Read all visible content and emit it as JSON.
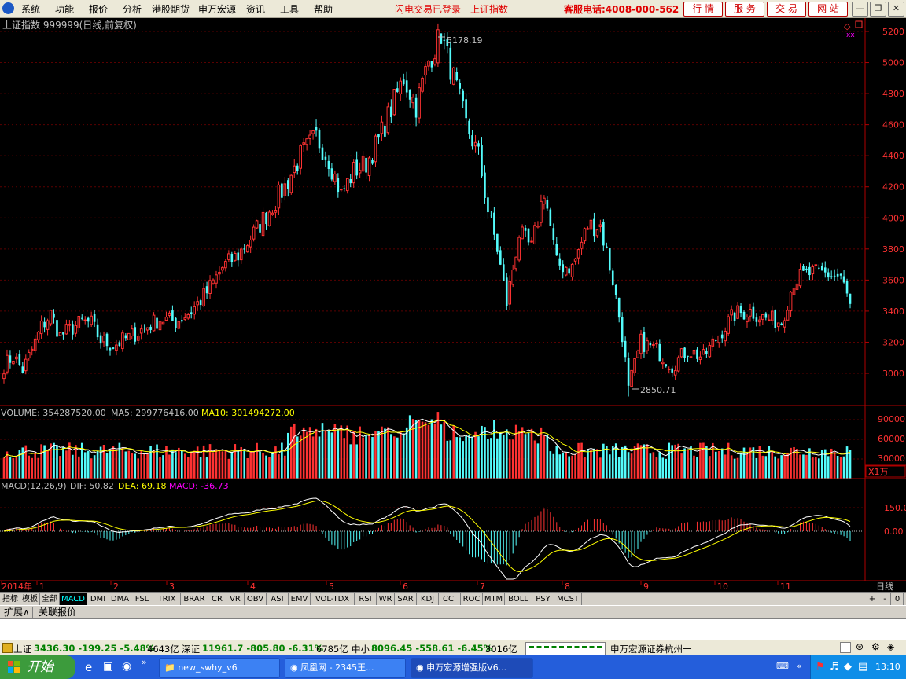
{
  "menubar": {
    "items": [
      "系统",
      "功能",
      "报价",
      "分析",
      "港股期货",
      "申万宏源",
      "资讯",
      "工具",
      "帮助"
    ],
    "notice1": "闪电交易已登录",
    "notice2": "上证指数",
    "hotline": "客服电话:4008-000-562",
    "buttons": [
      "行 情",
      "服 务",
      "交 易",
      "网 站"
    ]
  },
  "chart": {
    "title": "上证指数 999999(日线,前复权)",
    "high_label": "5178.19",
    "low_label": "2850.71",
    "price_ticks": [
      "5200",
      "5000",
      "4800",
      "4600",
      "4400",
      "4200",
      "4000",
      "3800",
      "3600",
      "3400",
      "3200",
      "3000"
    ],
    "volume_header": {
      "label": "VOLUME: 354287520.00",
      "ma5": "MA5: 299776416.00",
      "ma10": "MA10: 301494272.00"
    },
    "volume_ticks": [
      "90000",
      "60000",
      "30000"
    ],
    "volume_unit": "X1万",
    "macd_header": {
      "label": "MACD(12,26,9)",
      "dif": "DIF: 50.82",
      "dea": "DEA: 69.18",
      "macd": "MACD: -36.73"
    },
    "macd_ticks": [
      "150.0",
      "0.00"
    ],
    "x_labels": [
      "2014年",
      "1",
      "2",
      "3",
      "4",
      "5",
      "6",
      "7",
      "8",
      "9",
      "10",
      "11"
    ],
    "period": "日线",
    "colors": {
      "up": "#ff3232",
      "down": "#54fcfc",
      "dif": "#ffffff",
      "dea": "#ffff00",
      "macd": "#ff00ff",
      "axis": "#b00000"
    }
  },
  "chart_data": {
    "type": "candlestick",
    "title": "上证指数 999999(日线,前复权)",
    "ylim": [
      2850,
      5250
    ],
    "x_categories": [
      "1",
      "2",
      "3",
      "4",
      "5",
      "6",
      "7",
      "8",
      "9",
      "10",
      "11"
    ],
    "anchors": [
      {
        "pos": 0,
        "price": 3050
      },
      {
        "pos": 3,
        "price": 3110
      },
      {
        "pos": 6,
        "price": 3020
      },
      {
        "pos": 9,
        "price": 3150
      },
      {
        "pos": 12,
        "price": 3300
      },
      {
        "pos": 15,
        "price": 3380
      },
      {
        "pos": 18,
        "price": 3240
      },
      {
        "pos": 21,
        "price": 3280
      },
      {
        "pos": 25,
        "price": 3330
      },
      {
        "pos": 28,
        "price": 3320
      },
      {
        "pos": 31,
        "price": 3210
      },
      {
        "pos": 35,
        "price": 3180
      },
      {
        "pos": 40,
        "price": 3230
      },
      {
        "pos": 45,
        "price": 3290
      },
      {
        "pos": 50,
        "price": 3350
      },
      {
        "pos": 55,
        "price": 3330
      },
      {
        "pos": 60,
        "price": 3400
      },
      {
        "pos": 65,
        "price": 3520
      },
      {
        "pos": 70,
        "price": 3680
      },
      {
        "pos": 75,
        "price": 3760
      },
      {
        "pos": 80,
        "price": 3900
      },
      {
        "pos": 85,
        "price": 4050
      },
      {
        "pos": 90,
        "price": 4200
      },
      {
        "pos": 95,
        "price": 4400
      },
      {
        "pos": 100,
        "price": 4520
      },
      {
        "pos": 104,
        "price": 4380
      },
      {
        "pos": 108,
        "price": 4150
      },
      {
        "pos": 112,
        "price": 4300
      },
      {
        "pos": 116,
        "price": 4350
      },
      {
        "pos": 120,
        "price": 4500
      },
      {
        "pos": 124,
        "price": 4700
      },
      {
        "pos": 128,
        "price": 4900
      },
      {
        "pos": 132,
        "price": 4720
      },
      {
        "pos": 136,
        "price": 5010
      },
      {
        "pos": 140,
        "price": 5178
      },
      {
        "pos": 144,
        "price": 4900
      },
      {
        "pos": 148,
        "price": 4600
      },
      {
        "pos": 152,
        "price": 4400
      },
      {
        "pos": 155,
        "price": 4050
      },
      {
        "pos": 158,
        "price": 3800
      },
      {
        "pos": 161,
        "price": 3450
      },
      {
        "pos": 165,
        "price": 3900
      },
      {
        "pos": 169,
        "price": 3800
      },
      {
        "pos": 173,
        "price": 4180
      },
      {
        "pos": 177,
        "price": 3700
      },
      {
        "pos": 182,
        "price": 3680
      },
      {
        "pos": 187,
        "price": 3950
      },
      {
        "pos": 191,
        "price": 3950
      },
      {
        "pos": 195,
        "price": 3600
      },
      {
        "pos": 198,
        "price": 3250
      },
      {
        "pos": 200,
        "price": 2900
      },
      {
        "pos": 204,
        "price": 3200
      },
      {
        "pos": 209,
        "price": 3150
      },
      {
        "pos": 214,
        "price": 3050
      },
      {
        "pos": 219,
        "price": 3150
      },
      {
        "pos": 224,
        "price": 3100
      },
      {
        "pos": 229,
        "price": 3250
      },
      {
        "pos": 234,
        "price": 3380
      },
      {
        "pos": 239,
        "price": 3400
      },
      {
        "pos": 244,
        "price": 3350
      },
      {
        "pos": 249,
        "price": 3330
      },
      {
        "pos": 253,
        "price": 3600
      },
      {
        "pos": 258,
        "price": 3640
      },
      {
        "pos": 263,
        "price": 3640
      },
      {
        "pos": 268,
        "price": 3620
      },
      {
        "pos": 271,
        "price": 3430
      }
    ],
    "last_volume": 354287520,
    "ma5": 299776416,
    "ma10": 301494272,
    "macd": {
      "dif": 50.82,
      "dea": 69.18,
      "macd": -36.73
    }
  },
  "tabs": [
    "指标",
    "模板",
    "全部",
    "MACD",
    "DMI",
    "DMA",
    "FSL",
    "TRIX",
    "BRAR",
    "CR",
    "VR",
    "OBV",
    "ASI",
    "EMV",
    "VOL-TDX",
    "RSI",
    "WR",
    "SAR",
    "KDJ",
    "CCI",
    "ROC",
    "MTM",
    "BOLL",
    "PSY",
    "MCST"
  ],
  "selected_tab": "MACD",
  "tab_ctrl": [
    "+",
    "-",
    "0"
  ],
  "ext_tabs": [
    "扩展∧",
    "关联报价"
  ],
  "status": {
    "sh_label": "上证",
    "sh_value": "3436.30 -199.25 -5.48%",
    "sh_amount": "4643亿",
    "sz_label": "深证",
    "sz_value": "11961.7 -805.80 -6.31%",
    "sz_amount": "6785亿",
    "zx_label": "中小",
    "zx_value": "8096.45 -558.61 -6.45%",
    "zx_amount": "3016亿",
    "broker": "申万宏源证券杭州一"
  },
  "taskbar": {
    "start": "开始",
    "tasks": [
      "new_swhy_v6",
      "凤凰网 - 2345王...",
      "申万宏源增强版V6..."
    ],
    "clock": "13:10"
  }
}
